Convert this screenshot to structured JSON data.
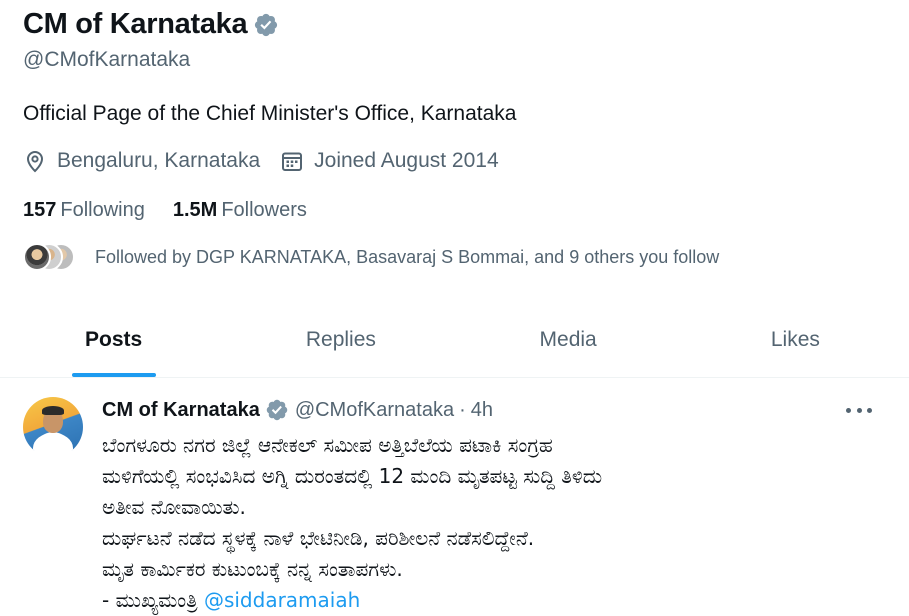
{
  "profile": {
    "name": "CM of Karnataka",
    "handle": "@CMofKarnataka",
    "bio": "Official Page of the Chief Minister's Office, Karnataka",
    "location": "Bengaluru, Karnataka",
    "joined": "Joined August 2014",
    "following_count": "157",
    "following_label": "Following",
    "followers_count": "1.5M",
    "followers_label": "Followers",
    "followed_by": "Followed by DGP KARNATAKA, Basavaraj S Bommai, and 9 others you follow"
  },
  "tabs": [
    {
      "label": "Posts",
      "active": true
    },
    {
      "label": "Replies",
      "active": false
    },
    {
      "label": "Media",
      "active": false
    },
    {
      "label": "Likes",
      "active": false
    }
  ],
  "tweet": {
    "author_name": "CM of Karnataka",
    "author_handle": "@CMofKarnataka",
    "separator": "·",
    "time": "4h",
    "lines": [
      "ಬೆಂಗಳೂರು ನಗರ ಜಿಲ್ಲೆ ಆನೇಕಲ್ ಸಮೀಪ ಅತ್ತಿಬೆಲೆಯ ಪಟಾಕಿ ಸಂಗ್ರಹ",
      "ಮಳಿಗೆಯಲ್ಲಿ ಸಂಭವಿಸಿದ ಅಗ್ನಿ ದುರಂತದಲ್ಲಿ 12 ಮಂದಿ ಮೃತಪಟ್ಟ ಸುದ್ದಿ ತಿಳಿದು",
      "ಅತೀವ ನೋವಾಯಿತು.",
      "ದುರ್ಘಟನೆ ನಡೆದ ಸ್ಥಳಕ್ಕೆ ನಾಳೆ ಭೇಟಿನೀಡಿ, ಪರಿಶೀಲನೆ ನಡೆಸಲಿದ್ದೇನೆ.",
      "ಮೃತ ಕಾರ್ಮಿಕರ ಕುಟುಂಬಕ್ಕೆ ನನ್ನ ಸಂತಾಪಗಳು."
    ],
    "signature": "- ಮುಖ್ಯಮಂತ್ರಿ ",
    "mention": "@siddaramaiah"
  },
  "colors": {
    "accent": "#1d9bf0",
    "verified": "#829aab",
    "muted_text": "#536471",
    "text": "#0f1419"
  },
  "icons": [
    "verified-badge-icon",
    "location-pin-icon",
    "calendar-icon",
    "more-options-icon"
  ]
}
